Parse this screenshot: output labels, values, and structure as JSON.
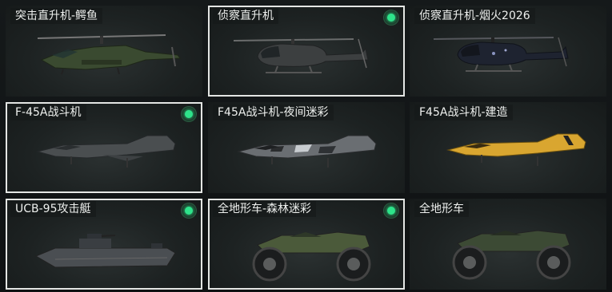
{
  "vehicles": [
    {
      "label": "突击直升机-鳄鱼",
      "icon": "attack-helicopter-icon",
      "color": "#3a4a30"
    },
    {
      "label": "侦察直升机",
      "icon": "scout-helicopter-icon",
      "color": "#3c3f40"
    },
    {
      "label": "侦察直升机-烟火2026",
      "icon": "scout-helicopter-icon",
      "color": "#1e2330"
    },
    {
      "label": "F-45A战斗机",
      "icon": "fighter-jet-icon",
      "color": "#4a4e50"
    },
    {
      "label": "F45A战斗机-夜间迷彩",
      "icon": "fighter-jet-icon",
      "color": "#6a6e72"
    },
    {
      "label": "F45A战斗机-建造",
      "icon": "fighter-jet-icon",
      "color": "#d9a630"
    },
    {
      "label": "UCB-95攻击艇",
      "icon": "attack-boat-icon",
      "color": "#4a4e52"
    },
    {
      "label": "全地形车-森林迷彩",
      "icon": "atv-icon",
      "color": "#4b5a3a"
    },
    {
      "label": "全地形车",
      "icon": "atv-icon",
      "color": "#3c4a34"
    }
  ],
  "colors": {
    "owned_indicator": "#2ee38a",
    "selected_border": "#e4e6e4"
  }
}
